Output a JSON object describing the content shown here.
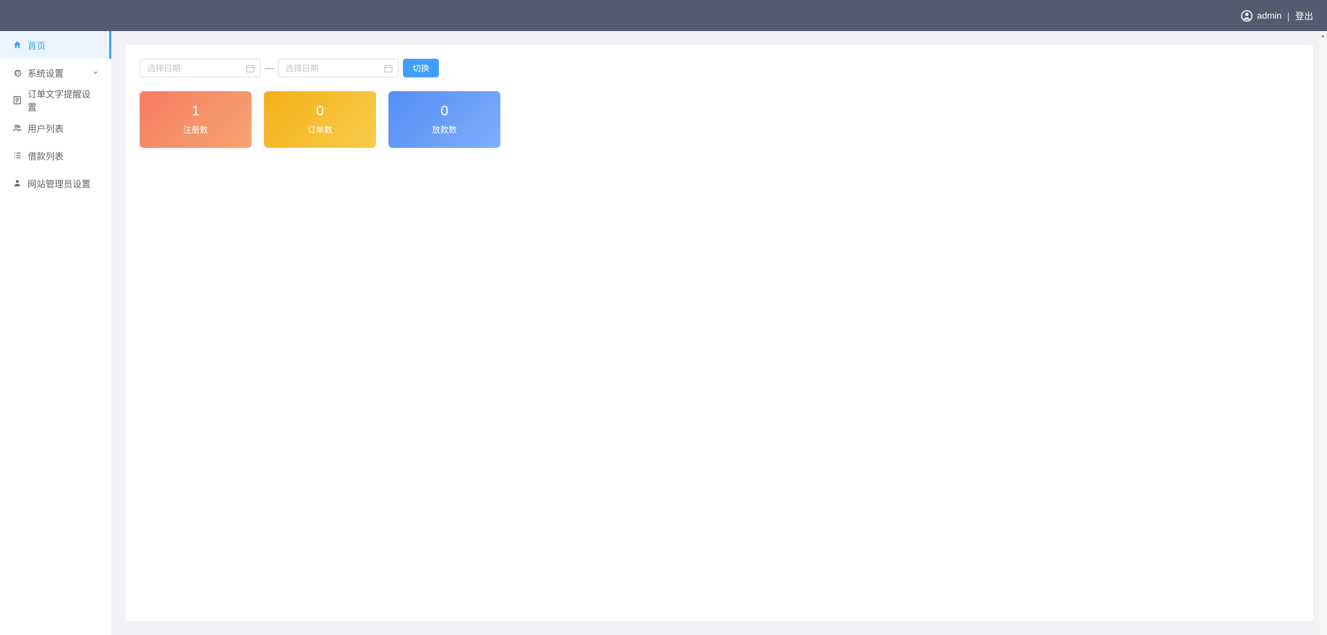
{
  "header": {
    "username": "admin",
    "logout_label": "登出"
  },
  "sidebar": {
    "items": [
      {
        "label": "首页",
        "icon": "home",
        "active": true,
        "expandable": false
      },
      {
        "label": "系统设置",
        "icon": "gear",
        "active": false,
        "expandable": true
      },
      {
        "label": "订单文字提醒设置",
        "icon": "doc",
        "active": false,
        "expandable": false
      },
      {
        "label": "用户列表",
        "icon": "users",
        "active": false,
        "expandable": false
      },
      {
        "label": "借款列表",
        "icon": "list",
        "active": false,
        "expandable": false
      },
      {
        "label": "网站管理员设置",
        "icon": "person",
        "active": false,
        "expandable": false
      }
    ]
  },
  "dashboard": {
    "date_range": {
      "start_placeholder": "选择日期",
      "end_placeholder": "选择日期",
      "separator": "—",
      "switch_label": "切换"
    },
    "stats": [
      {
        "value": "1",
        "label": "注册数",
        "color": "orange"
      },
      {
        "value": "0",
        "label": "订单数",
        "color": "yellow"
      },
      {
        "value": "0",
        "label": "放款数",
        "color": "blue"
      }
    ]
  }
}
